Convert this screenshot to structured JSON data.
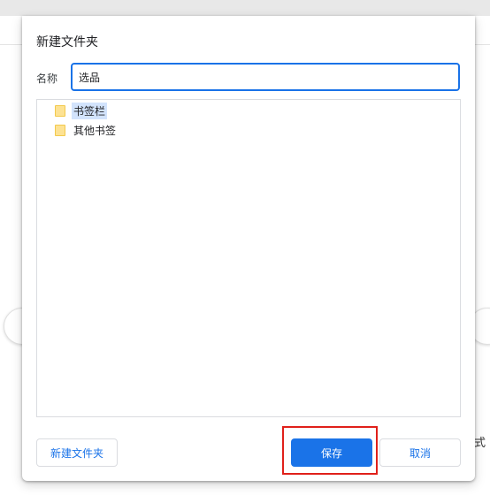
{
  "dialog": {
    "title": "新建文件夹",
    "name_label": "名称",
    "name_value": "选品"
  },
  "tree": {
    "items": [
      {
        "label": "书签栏",
        "selected": true
      },
      {
        "label": "其他书签",
        "selected": false
      }
    ]
  },
  "buttons": {
    "new_folder": "新建文件夹",
    "save": "保存",
    "cancel": "取消"
  },
  "background": {
    "stray_text": "式"
  },
  "colors": {
    "accent": "#1a73e8",
    "highlight": "#e0201a",
    "selection": "#d2e3fc",
    "folder": "#fde293"
  }
}
